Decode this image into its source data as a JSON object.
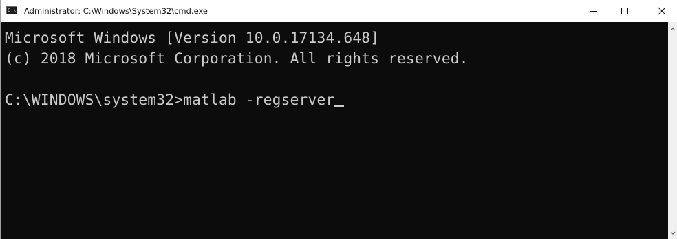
{
  "window": {
    "title": "Administrator: C:\\Windows\\System32\\cmd.exe",
    "app_icon_glyph": "C:\\"
  },
  "titlebar_buttons": {
    "minimize_icon": "minimize-icon",
    "maximize_icon": "maximize-icon",
    "close_icon": "close-icon"
  },
  "console": {
    "lines": [
      "Microsoft Windows [Version 10.0.17134.648]",
      "(c) 2018 Microsoft Corporation. All rights reserved.",
      "",
      "C:\\WINDOWS\\system32>matlab -regserver"
    ]
  },
  "colors": {
    "console_background": "#0c0c0c",
    "console_text": "#cccccc",
    "titlebar_background": "#ffffff",
    "scrollbar_background": "#f0f0f0"
  }
}
